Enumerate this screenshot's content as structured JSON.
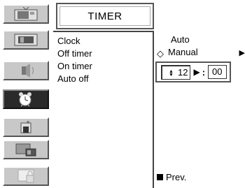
{
  "title": "TIMER",
  "menu": {
    "items": [
      "Clock",
      "Off timer",
      "On timer",
      "Auto off"
    ]
  },
  "options": {
    "auto": "Auto",
    "manual": "Manual",
    "diamond": "◇",
    "arrow": "▶"
  },
  "time": {
    "updown": "▲▼",
    "hour": "12",
    "separator_arrow": "▶",
    "colon": ":",
    "minute": "00"
  },
  "prev": {
    "label": "Prev."
  },
  "sidebar": {
    "icons": [
      "picture-icon",
      "screen-icon",
      "audio-icon",
      "timer-icon",
      "special-icon",
      "pip-icon",
      "lock-icon"
    ],
    "active_index": 3
  }
}
